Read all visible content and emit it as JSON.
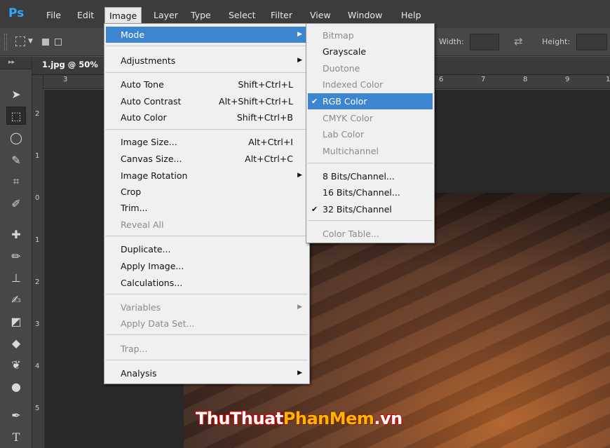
{
  "app": {
    "logo": "Ps"
  },
  "menubar": [
    "File",
    "Edit",
    "Image",
    "Layer",
    "Type",
    "Select",
    "Filter",
    "View",
    "Window",
    "Help"
  ],
  "options": {
    "width_label": "Width:",
    "height_label": "Height:"
  },
  "document": {
    "tab_title": "1.jpg @ 50%"
  },
  "ruler_top": [
    "3",
    "6",
    "7",
    "8",
    "9",
    "1"
  ],
  "ruler_left": [
    "2",
    "1",
    "0",
    "1",
    "2",
    "3",
    "4",
    "5"
  ],
  "image_menu": {
    "mode": "Mode",
    "adjustments": "Adjustments",
    "auto_tone": "Auto Tone",
    "auto_tone_sc": "Shift+Ctrl+L",
    "auto_contrast": "Auto Contrast",
    "auto_contrast_sc": "Alt+Shift+Ctrl+L",
    "auto_color": "Auto Color",
    "auto_color_sc": "Shift+Ctrl+B",
    "image_size": "Image Size...",
    "image_size_sc": "Alt+Ctrl+I",
    "canvas_size": "Canvas Size...",
    "canvas_size_sc": "Alt+Ctrl+C",
    "image_rotation": "Image Rotation",
    "crop": "Crop",
    "trim": "Trim...",
    "reveal_all": "Reveal All",
    "duplicate": "Duplicate...",
    "apply_image": "Apply Image...",
    "calculations": "Calculations...",
    "variables": "Variables",
    "apply_data_set": "Apply Data Set...",
    "trap": "Trap...",
    "analysis": "Analysis"
  },
  "mode_menu": {
    "bitmap": "Bitmap",
    "grayscale": "Grayscale",
    "duotone": "Duotone",
    "indexed_color": "Indexed Color",
    "rgb_color": "RGB Color",
    "cmyk_color": "CMYK Color",
    "lab_color": "Lab Color",
    "multichannel": "Multichannel",
    "bits8": "8 Bits/Channel...",
    "bits16": "16 Bits/Channel...",
    "bits32": "32 Bits/Channel",
    "color_table": "Color Table...",
    "check": "✔"
  },
  "watermark": {
    "part1": "ThuThuat",
    "part2": "PhanMem",
    "part3": ".vn"
  },
  "colors": {
    "highlight": "#3d86cf",
    "ps_blue": "#31a8ff"
  }
}
